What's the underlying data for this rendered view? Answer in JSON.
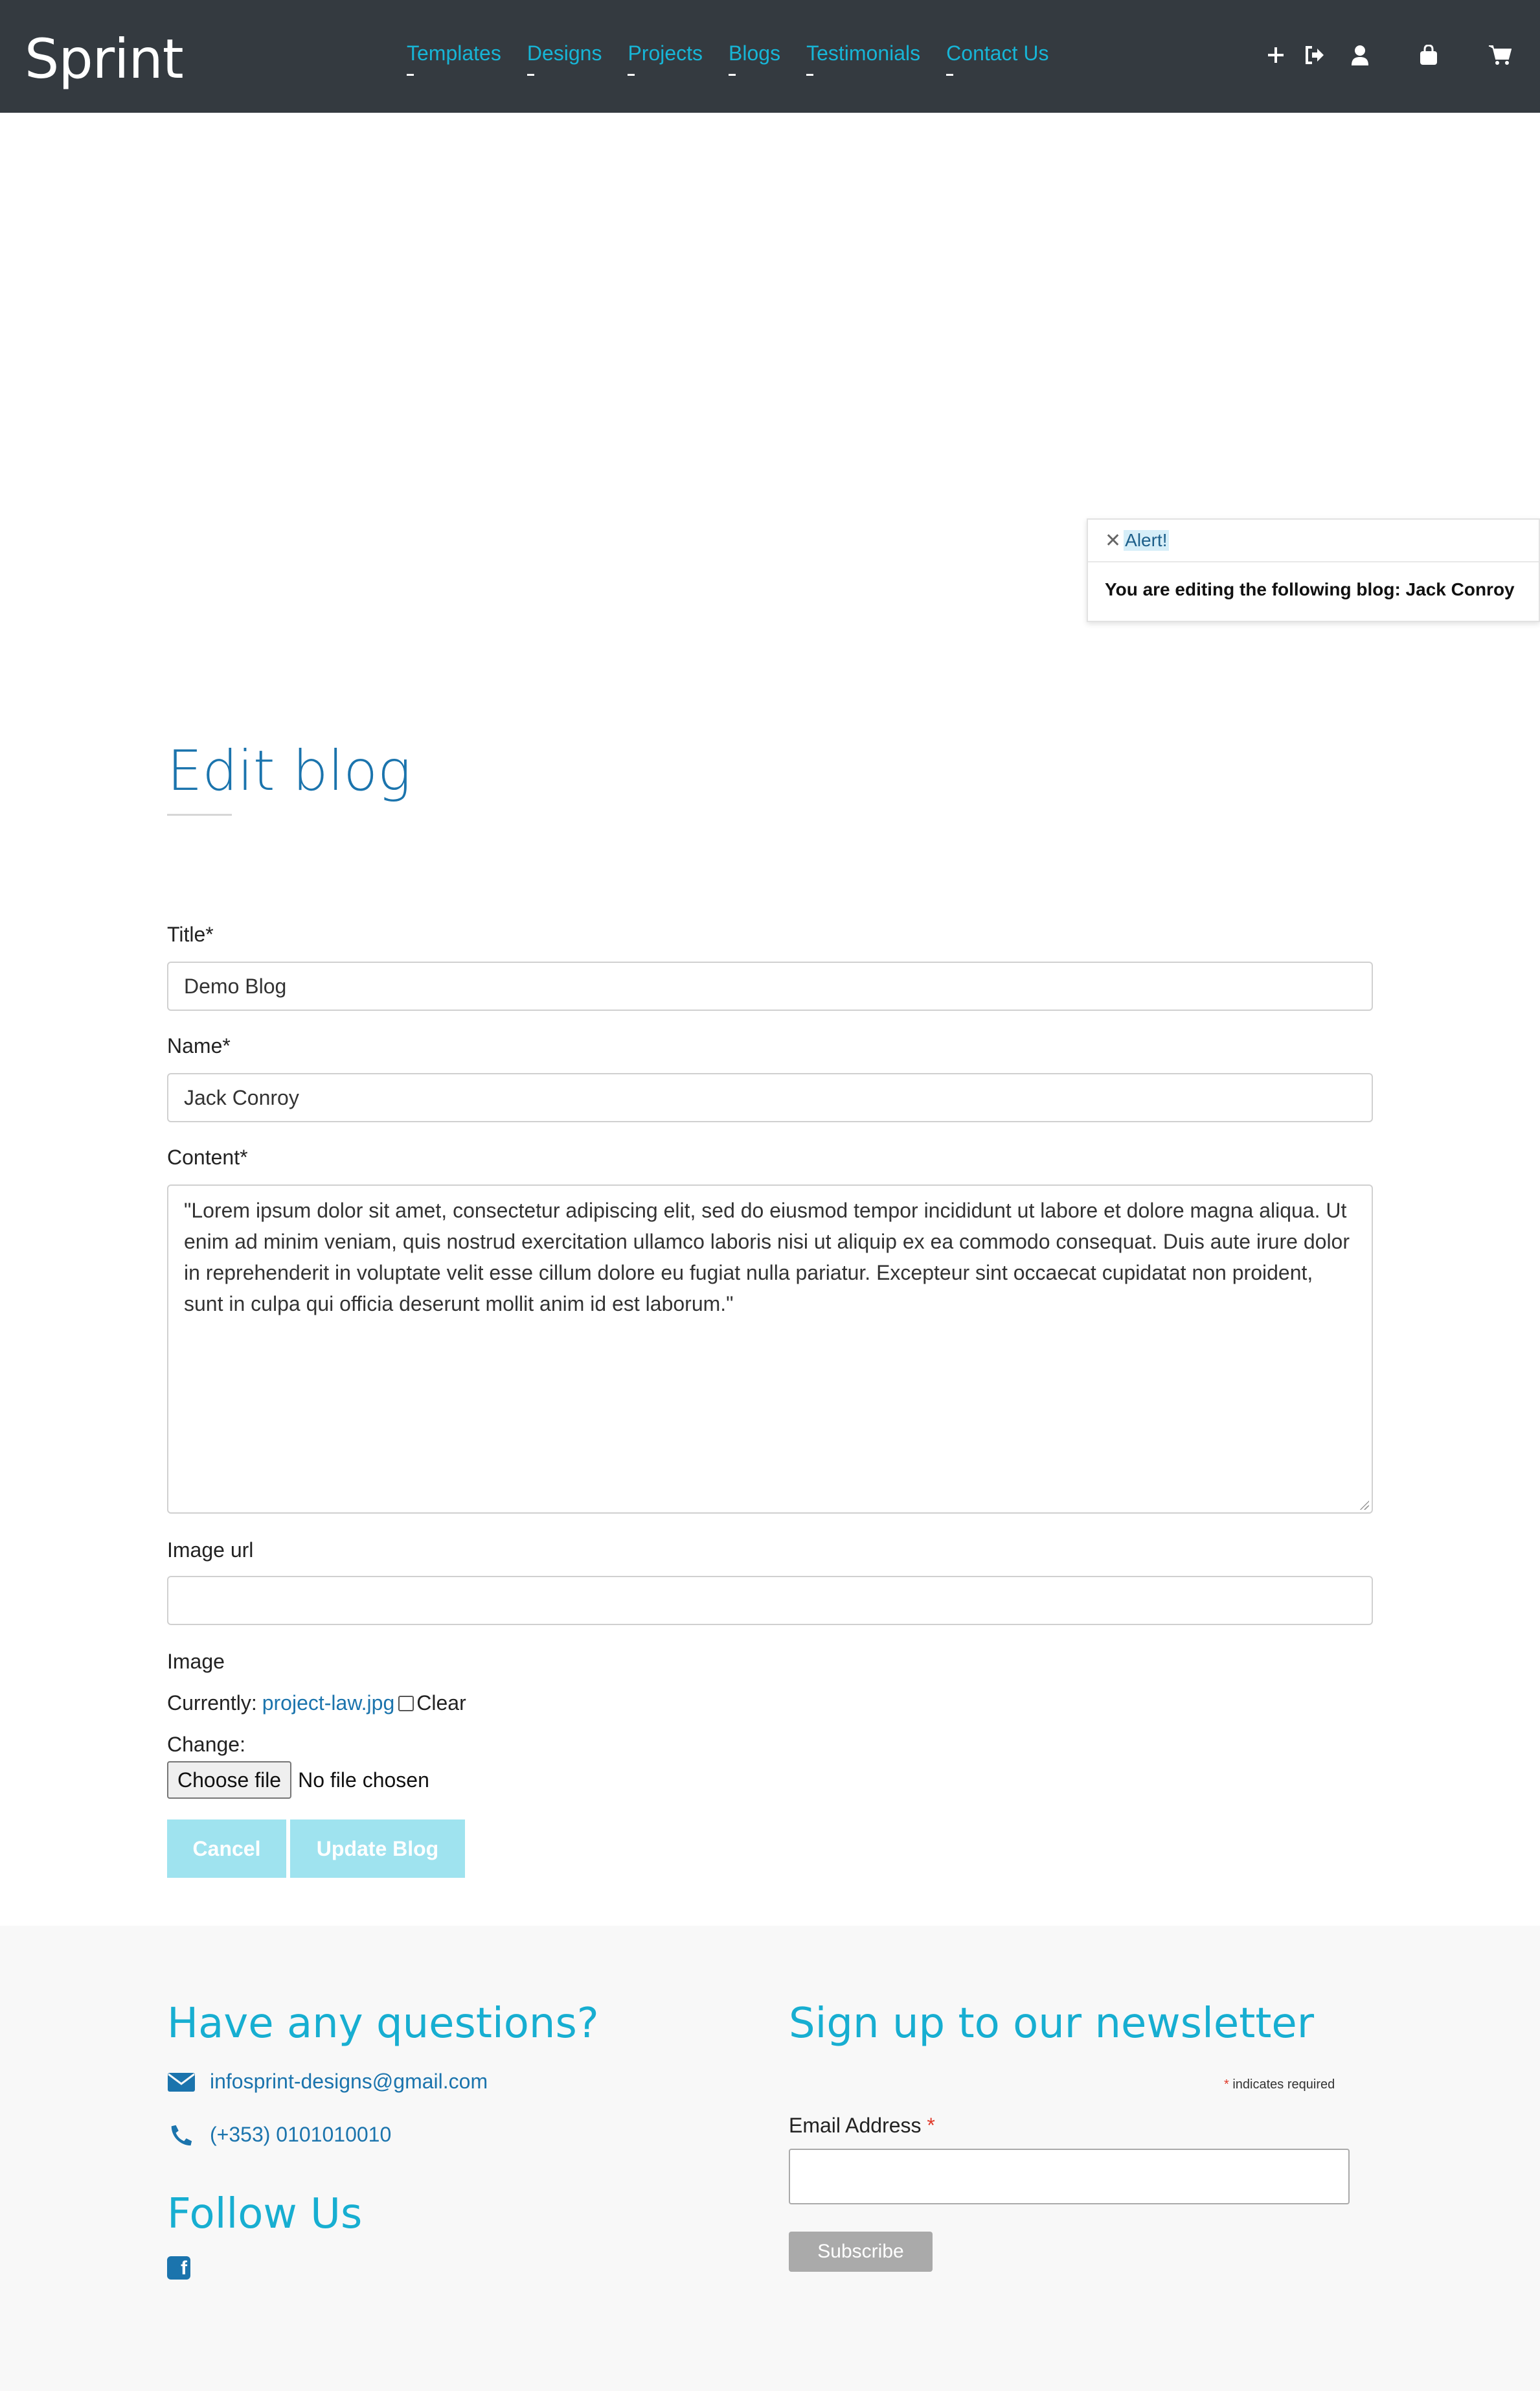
{
  "nav": {
    "brand": "Sprint",
    "links": [
      "Templates",
      "Designs",
      "Projects",
      "Blogs",
      "Testimonials",
      "Contact Us"
    ],
    "icons": [
      "plus-icon",
      "sign-out-icon",
      "user-icon",
      "shopping-bag-icon",
      "cart-icon"
    ]
  },
  "alert": {
    "title": "Alert!",
    "message": "You are editing the following blog: Jack Conroy"
  },
  "form": {
    "heading": "Edit blog",
    "title_label": "Title*",
    "title_value": "Demo Blog",
    "name_label": "Name*",
    "name_value": "Jack Conroy",
    "content_label": "Content*",
    "content_value": "\"Lorem ipsum dolor sit amet, consectetur adipiscing elit, sed do eiusmod tempor incididunt ut labore et dolore magna aliqua. Ut enim ad minim veniam, quis nostrud exercitation ullamco laboris nisi ut aliquip ex ea commodo consequat. Duis aute irure dolor in reprehenderit in voluptate velit esse cillum dolore eu fugiat nulla pariatur. Excepteur sint occaecat cupidatat non proident, sunt in culpa qui officia deserunt mollit anim id est laborum.\"",
    "image_url_label": "Image url",
    "image_url_value": "",
    "image_label": "Image",
    "currently_label": "Currently:",
    "current_file": "project-law.jpg",
    "clear_label": "Clear",
    "change_label": "Change:",
    "choose_file_label": "Choose file",
    "file_status": "No file chosen",
    "cancel_label": "Cancel",
    "update_label": "Update Blog"
  },
  "footer": {
    "questions_heading": "Have any questions?",
    "email": "infosprint-designs@gmail.com",
    "phone": "(+353) 0101010010",
    "follow_heading": "Follow Us",
    "newsletter_heading": "Sign up to our newsletter",
    "required_note": "indicates required",
    "required_star": "*",
    "email_label": "Email Address",
    "subscribe_label": "Subscribe"
  }
}
